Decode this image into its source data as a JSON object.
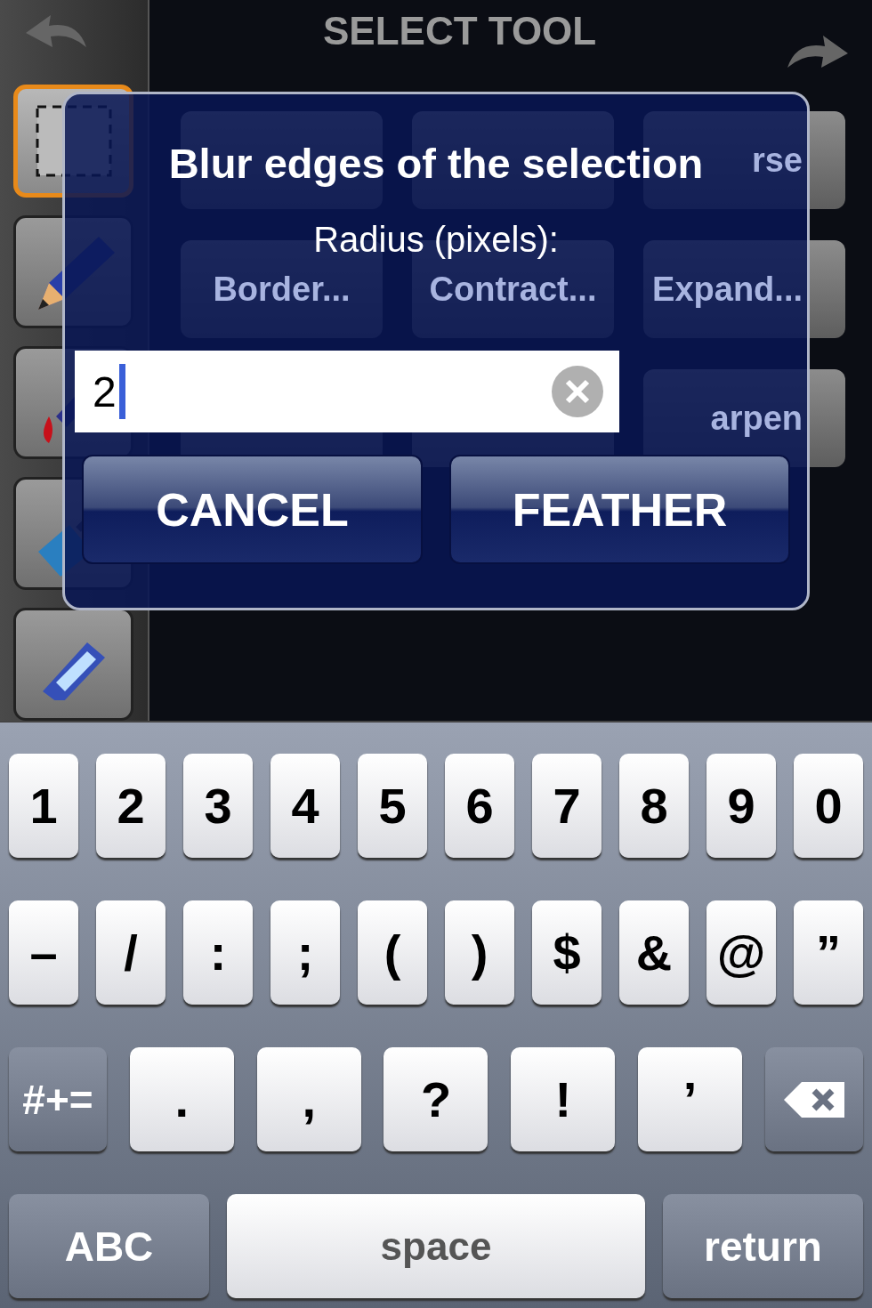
{
  "header": {
    "title": "SELECT TOOL"
  },
  "tools": [
    {
      "kind": "marquee",
      "selected": true
    },
    {
      "kind": "pencil",
      "selected": false
    },
    {
      "kind": "dropper",
      "selected": false
    },
    {
      "kind": "brush",
      "selected": false
    },
    {
      "kind": "tube",
      "selected": false
    }
  ],
  "menu_buttons": [
    {
      "label": "rse"
    },
    {
      "label": "Border..."
    },
    {
      "label": "Contract..."
    },
    {
      "label": "Expand..."
    },
    {
      "label": "arpen"
    }
  ],
  "dialog": {
    "title": "Blur edges of the selection",
    "prompt": "Radius (pixels):",
    "field": {
      "value": "2"
    },
    "buttons": [
      {
        "label": "CANCEL"
      },
      {
        "label": "FEATHER"
      }
    ]
  },
  "keyboard": {
    "number_row": [
      {
        "kind": "char",
        "label": "1"
      },
      {
        "kind": "char",
        "label": "2"
      },
      {
        "kind": "char",
        "label": "3"
      },
      {
        "kind": "char",
        "label": "4"
      },
      {
        "kind": "char",
        "label": "5"
      },
      {
        "kind": "char",
        "label": "6"
      },
      {
        "kind": "char",
        "label": "7"
      },
      {
        "kind": "char",
        "label": "8"
      },
      {
        "kind": "char",
        "label": "9"
      },
      {
        "kind": "char",
        "label": "0"
      }
    ],
    "symbol_row": [
      {
        "kind": "char",
        "label": "–"
      },
      {
        "kind": "char",
        "label": "/"
      },
      {
        "kind": "char",
        "label": ":"
      },
      {
        "kind": "char",
        "label": ";"
      },
      {
        "kind": "char",
        "label": "("
      },
      {
        "kind": "char",
        "label": ")"
      },
      {
        "kind": "char",
        "label": "$"
      },
      {
        "kind": "char",
        "label": "&"
      },
      {
        "kind": "char",
        "label": "@"
      },
      {
        "kind": "char",
        "label": "”"
      }
    ],
    "punctuation_row": [
      {
        "kind": "mode",
        "label": "#+="
      },
      {
        "kind": "wide",
        "label": "."
      },
      {
        "kind": "wide",
        "label": ","
      },
      {
        "kind": "wide",
        "label": "?"
      },
      {
        "kind": "wide",
        "label": "!"
      },
      {
        "kind": "wide",
        "label": "’"
      },
      {
        "kind": "backspace"
      }
    ],
    "bottom_row": [
      {
        "kind": "mode",
        "label": "ABC"
      },
      {
        "kind": "space",
        "label": "space"
      },
      {
        "kind": "return",
        "label": "return"
      }
    ]
  }
}
